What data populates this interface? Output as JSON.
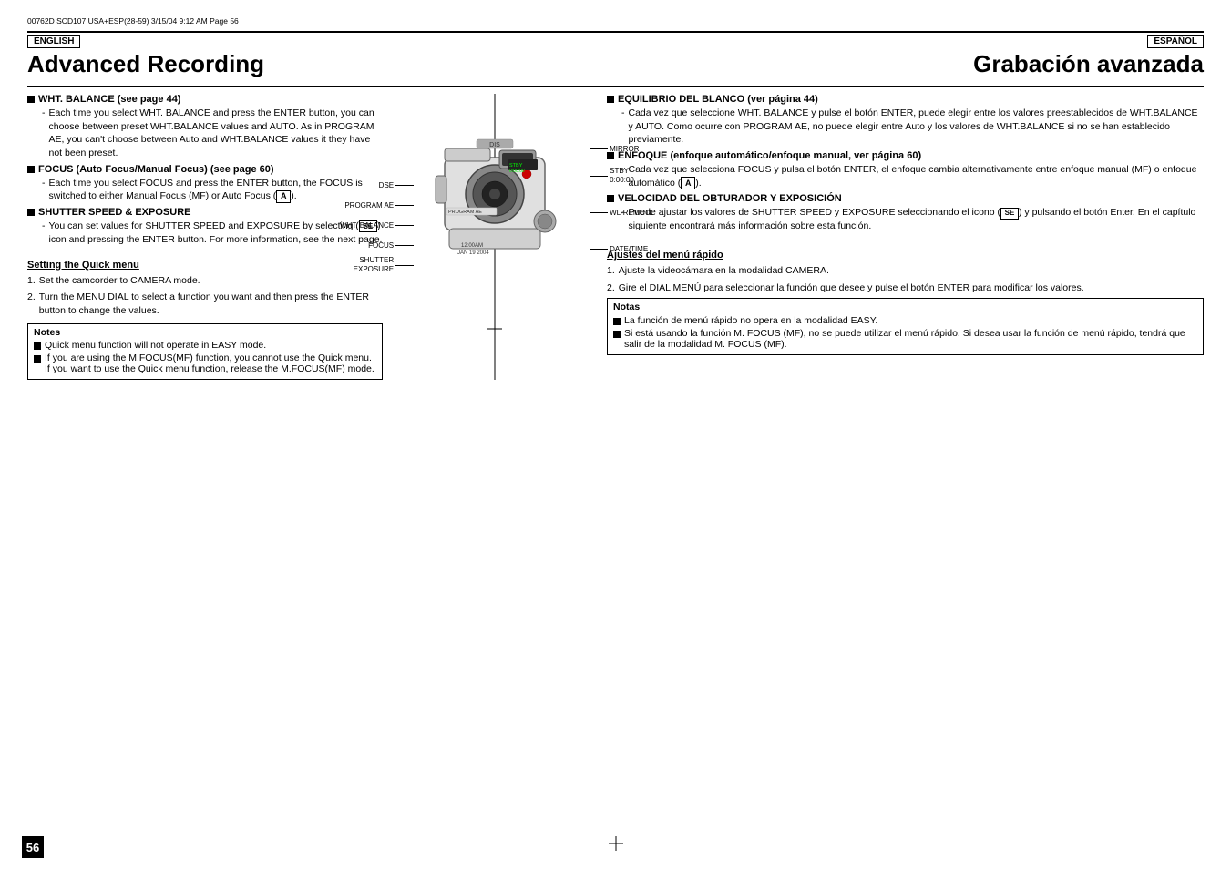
{
  "meta": {
    "file_info": "00762D SCD107 USA+ESP(28-59)   3/15/04  9:12 AM    Page 56",
    "page_number": "56"
  },
  "english": {
    "lang_label": "ENGLISH",
    "title": "Advanced Recording",
    "sections": [
      {
        "id": "wht-balance",
        "heading": "WHT. BALANCE (see page 44)",
        "body": "Each time you select WHT. BALANCE and press the ENTER button, you can choose between preset WHT.BALANCE values and AUTO. As in PROGRAM AE, you can't choose between Auto and WHT.BALANCE values it they have not been preset."
      },
      {
        "id": "focus",
        "heading": "FOCUS (Auto Focus/Manual Focus) (see page 60)",
        "body": "Each time you select FOCUS and press the ENTER button, the FOCUS is switched to either Manual Focus (MF) or Auto Focus"
      },
      {
        "id": "shutter",
        "heading": "SHUTTER SPEED & EXPOSURE",
        "body": "You can set values for SHUTTER SPEED and EXPOSURE by selecting icon and pressing the ENTER button. For more information, see the next page."
      }
    ],
    "quick_menu": {
      "title": "Setting the Quick menu",
      "steps": [
        "Set the camcorder to CAMERA mode.",
        "Turn the MENU DIAL to select a function you want and then press the ENTER button to change the values."
      ]
    },
    "notes": {
      "title": "Notes",
      "items": [
        "Quick menu function will not operate in EASY mode.",
        "If you are using the M.FOCUS(MF) function, you cannot use the Quick menu.\nIf you want to use the Quick menu function, release the M.FOCUS(MF) mode."
      ]
    }
  },
  "spanish": {
    "lang_label": "ESPAÑOL",
    "title": "Grabación avanzada",
    "sections": [
      {
        "id": "equilibrio",
        "heading": "EQUILIBRIO DEL BLANCO (ver página 44)",
        "body": "Cada vez que seleccione WHT. BALANCE y pulse el botón ENTER, puede elegir entre los valores preestablecidos de WHT.BALANCE y AUTO. Como ocurre con PROGRAM AE, no puede elegir entre Auto y los valores de WHT.BALANCE si no se han establecido previamente."
      },
      {
        "id": "enfoque",
        "heading": "ENFOQUE (enfoque automático/enfoque manual, ver página 60)",
        "body": "Cada vez que selecciona FOCUS y pulsa el botón ENTER, el enfoque cambia alternativamente entre enfoque manual (MF) o enfoque automático"
      },
      {
        "id": "velocidad",
        "heading": "VELOCIDAD DEL OBTURADOR Y EXPOSICIÓN",
        "body": "Puede ajustar los valores de SHUTTER SPEED y EXPOSURE seleccionando el icono y pulsando el botón Enter. En el capítulo siguiente encontrará más información sobre esta función."
      }
    ],
    "quick_menu": {
      "title": "Ajustes del menú rápido",
      "steps": [
        "Ajuste la videocámara en la modalidad CAMERA.",
        "Gire el DIAL MENÚ para seleccionar la función que desee y pulse el botón ENTER para modificar los valores."
      ]
    },
    "notes": {
      "title": "Notas",
      "items": [
        "La función de menú rápido no opera en la modalidad EASY.",
        "Si está usando la función M. FOCUS (MF), no se puede utilizar el menú rápido. Si desea usar la función de menú rápido, tendrá que salir de la modalidad M. FOCUS (MF)."
      ]
    }
  },
  "diagram": {
    "labels_left": [
      "DSE",
      "PROGRAM AE",
      "WHT. BALANCE",
      "FOCUS",
      "SHUTTER\nEXPOSURE"
    ],
    "labels_right": [
      "DIS",
      "STBY\n0:00:00",
      "WL-REMOTE",
      "DATE/TIME"
    ],
    "label_right_top": "MIRROR",
    "label_bottom": "12:00AM\nJAN 19 2004"
  }
}
